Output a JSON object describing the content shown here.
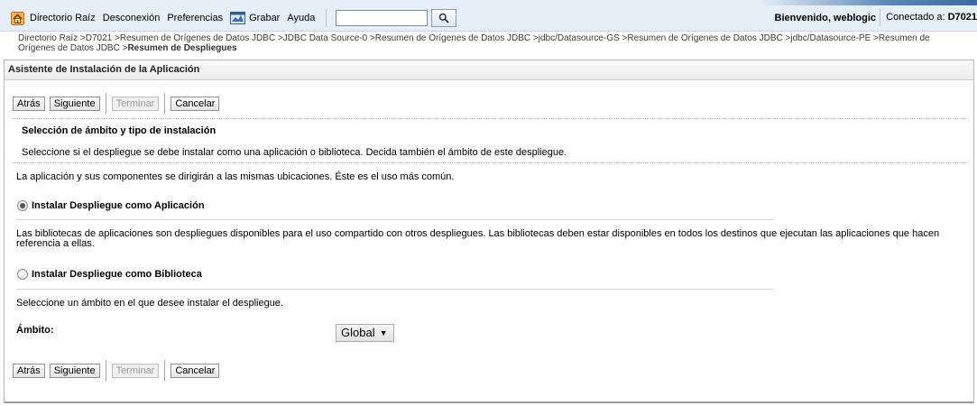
{
  "topbar": {
    "nav": {
      "home": "Directorio Raíz",
      "logout": "Desconexión",
      "preferences": "Preferencias",
      "record": "Grabar",
      "help": "Ayuda"
    },
    "search_value": "",
    "welcome": "Bienvenido, weblogic",
    "connected_label": "Conectado a:",
    "connected_domain": "D7021"
  },
  "breadcrumb": {
    "items": [
      "Directorio Raíz",
      "D7021",
      "Resumen de Orígenes de Datos JDBC",
      "JDBC Data Source-0",
      "Resumen de Orígenes de Datos JDBC",
      "jdbc/Datasource-GS",
      "Resumen de Orígenes de Datos JDBC",
      "jdbc/Datasource-PE",
      "Resumen de Orígenes de Datos JDBC"
    ],
    "current": "Resumen de Despliegues"
  },
  "wizard": {
    "title": "Asistente de Instalación de la Aplicación",
    "buttons": {
      "back": "Atrás",
      "next": "Siguiente",
      "finish": "Terminar",
      "cancel": "Cancelar"
    },
    "section_title": "Selección de ámbito y tipo de instalación",
    "section_desc": "Seleccione si el despliegue se debe instalar como una aplicación o biblioteca. Decida también el ámbito de este despliegue.",
    "app_desc": "La aplicación y sus componentes se dirigirán a las mismas ubicaciones. Éste es el uso más común.",
    "app_option": "Instalar Despliegue como Aplicación",
    "lib_desc": "Las bibliotecas de aplicaciones son despliegues disponibles para el uso compartido con otros despliegues. Las bibliotecas deben estar disponibles en todos los destinos que ejecutan las aplicaciones que hacen referencia a ellas.",
    "lib_option": "Instalar Despliegue como Biblioteca",
    "scope_desc": "Seleccione un ámbito en el que desee instalar el despliegue.",
    "scope_label": "Ámbito:",
    "scope_value": "Global"
  },
  "colors": {
    "topbar_bg": "#e6eef7",
    "accent": "#3f6aa0"
  },
  "icons": [
    "home-icon",
    "record-icon",
    "search-icon",
    "dropdown-caret-icon"
  ]
}
